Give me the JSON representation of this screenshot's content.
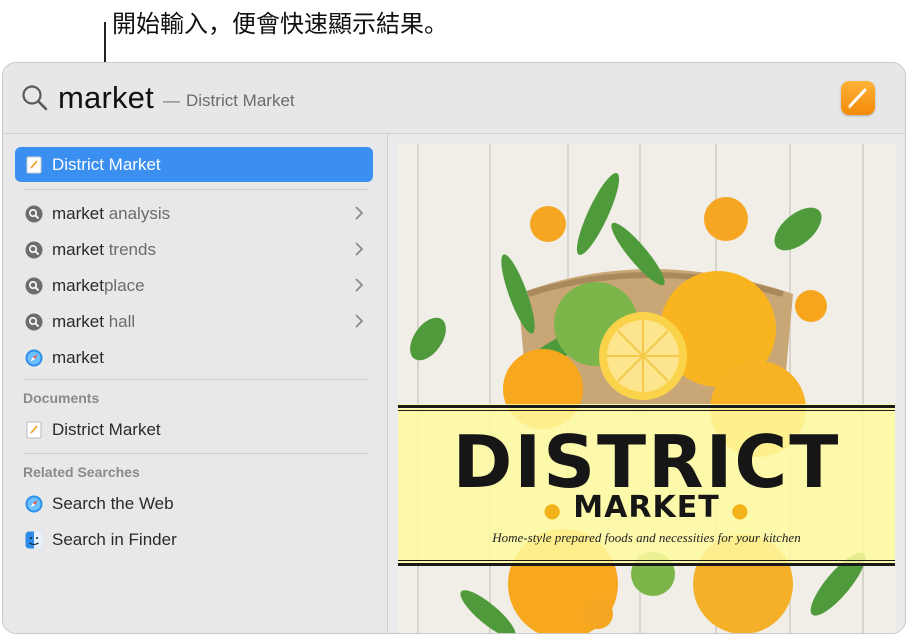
{
  "callout": {
    "text": "開始輸入，便會快速顯示結果。"
  },
  "search": {
    "query": "market",
    "dash": "—",
    "completion": "District Market"
  },
  "results": {
    "top_hit": "District Market",
    "suggestions": [
      {
        "bold": "market",
        "rest": " analysis",
        "icon": "search-suggestion-icon",
        "chevron": true
      },
      {
        "bold": "market",
        "rest": " trends",
        "icon": "search-suggestion-icon",
        "chevron": true
      },
      {
        "bold": "market",
        "rest": "place",
        "icon": "search-suggestion-icon",
        "chevron": true
      },
      {
        "bold": "market",
        "rest": " hall",
        "icon": "search-suggestion-icon",
        "chevron": true
      },
      {
        "bold": "market",
        "rest": "",
        "icon": "safari-icon",
        "chevron": false
      }
    ],
    "documents_header": "Documents",
    "document_item": "District Market",
    "related_header": "Related Searches",
    "related": [
      {
        "label": "Search the Web",
        "icon": "safari-icon"
      },
      {
        "label": "Search in Finder",
        "icon": "finder-icon"
      }
    ]
  },
  "preview": {
    "title": "DISTRICT",
    "subtitle": "MARKET",
    "tagline": "Home-style prepared foods and necessities for your kitchen"
  },
  "colors": {
    "selection": "#3a8ff0",
    "pages_orange": "#f5930f",
    "band_yellow": "#fffaa0"
  }
}
